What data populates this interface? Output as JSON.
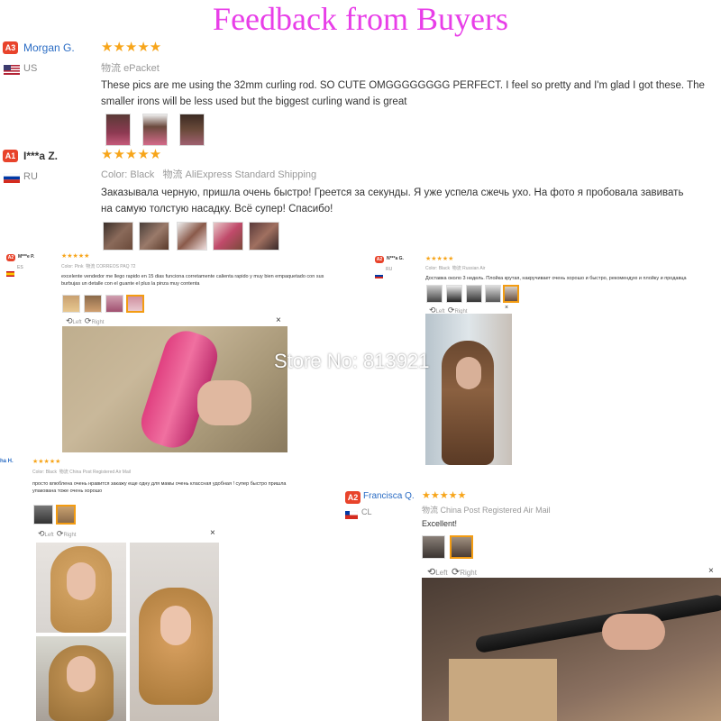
{
  "header": {
    "title": "Feedback  from Buyers"
  },
  "watermark": "Store No: 813921",
  "colors": {
    "title": "#e83ee8",
    "name_link": "#2a6cc4",
    "star": "#f7a51a",
    "level_badge": "#e8432b",
    "selected_thumb": "#f39c12"
  },
  "reviews": [
    {
      "level": "A3",
      "name": "Morgan G.",
      "country": "US",
      "stars": "★★★★★",
      "logistics_label": "物流",
      "logistics": "ePacket",
      "color": "",
      "text_line1": "These pics are me using the 32mm curling rod. SO CUTE OMGGGGGGGG PERFECT. I feel so pretty and I'm glad I got these. The",
      "text_line2": "smaller irons will be less used but the biggest curling wand is great"
    },
    {
      "level": "A1",
      "name": "I***a Z.",
      "country": "RU",
      "stars": "★★★★★",
      "color": "Color: Black",
      "logistics_label": "物流",
      "logistics": "AliExpress Standard Shipping",
      "text_line1": "Заказывала черную, пришла очень быстро! Греется за секунды. Я уже успела сжечь ухо. На фото я пробовала завивать",
      "text_line2": "на самую толстую насадку. Всё супер! Спасибо!"
    },
    {
      "level": "A2",
      "name": "M***e P.",
      "country": "ES",
      "stars": "★★★★★",
      "color": "Color: Pink",
      "logistics_label": "物流",
      "logistics": "CORREOS PAQ 72",
      "text_line1": "excelente vendedor me llego rapido en 15 dias funciona corretamente calienta rapido y muy bien empaquetado con sus",
      "text_line2": "burbujas un detalle con el guante el plus la pinza muy contenta",
      "viewer": {
        "left": "Left",
        "right": "Right",
        "close": "×"
      }
    },
    {
      "level": "A2",
      "name": "N***a G.",
      "country": "RU",
      "stars": "★★★★★",
      "color": "Color: Black",
      "logistics_label": "物流",
      "logistics": "Russian Air",
      "text_line1": "Доставка около 3 недель. Плойка крутая, накручивает очень хорошо и быстро, рекомендую и плойку и продавца",
      "viewer": {
        "left": "Left",
        "right": "Right",
        "close": "×"
      }
    },
    {
      "level": "",
      "name": "ha H.",
      "country": "",
      "stars": "★★★★★",
      "color": "Color: Black",
      "logistics_label": "物流",
      "logistics": "China Post Registered Air Mail",
      "text_line1": "просто влюблена очень нравится закажу еще одну для мамы очень классная удобная ! супер быстро пришла",
      "text_line2": "упакована тоже очень хорошо",
      "viewer": {
        "left": "Left",
        "right": "Right",
        "close": "×"
      }
    },
    {
      "level": "A2",
      "name": "Francisca Q.",
      "country": "CL",
      "stars": "★★★★★",
      "color": "",
      "logistics_label": "物流",
      "logistics": "China Post Registered Air Mail",
      "text_line1": "Excellent!",
      "viewer": {
        "left": "Left",
        "right": "Right",
        "close": "×"
      }
    }
  ]
}
